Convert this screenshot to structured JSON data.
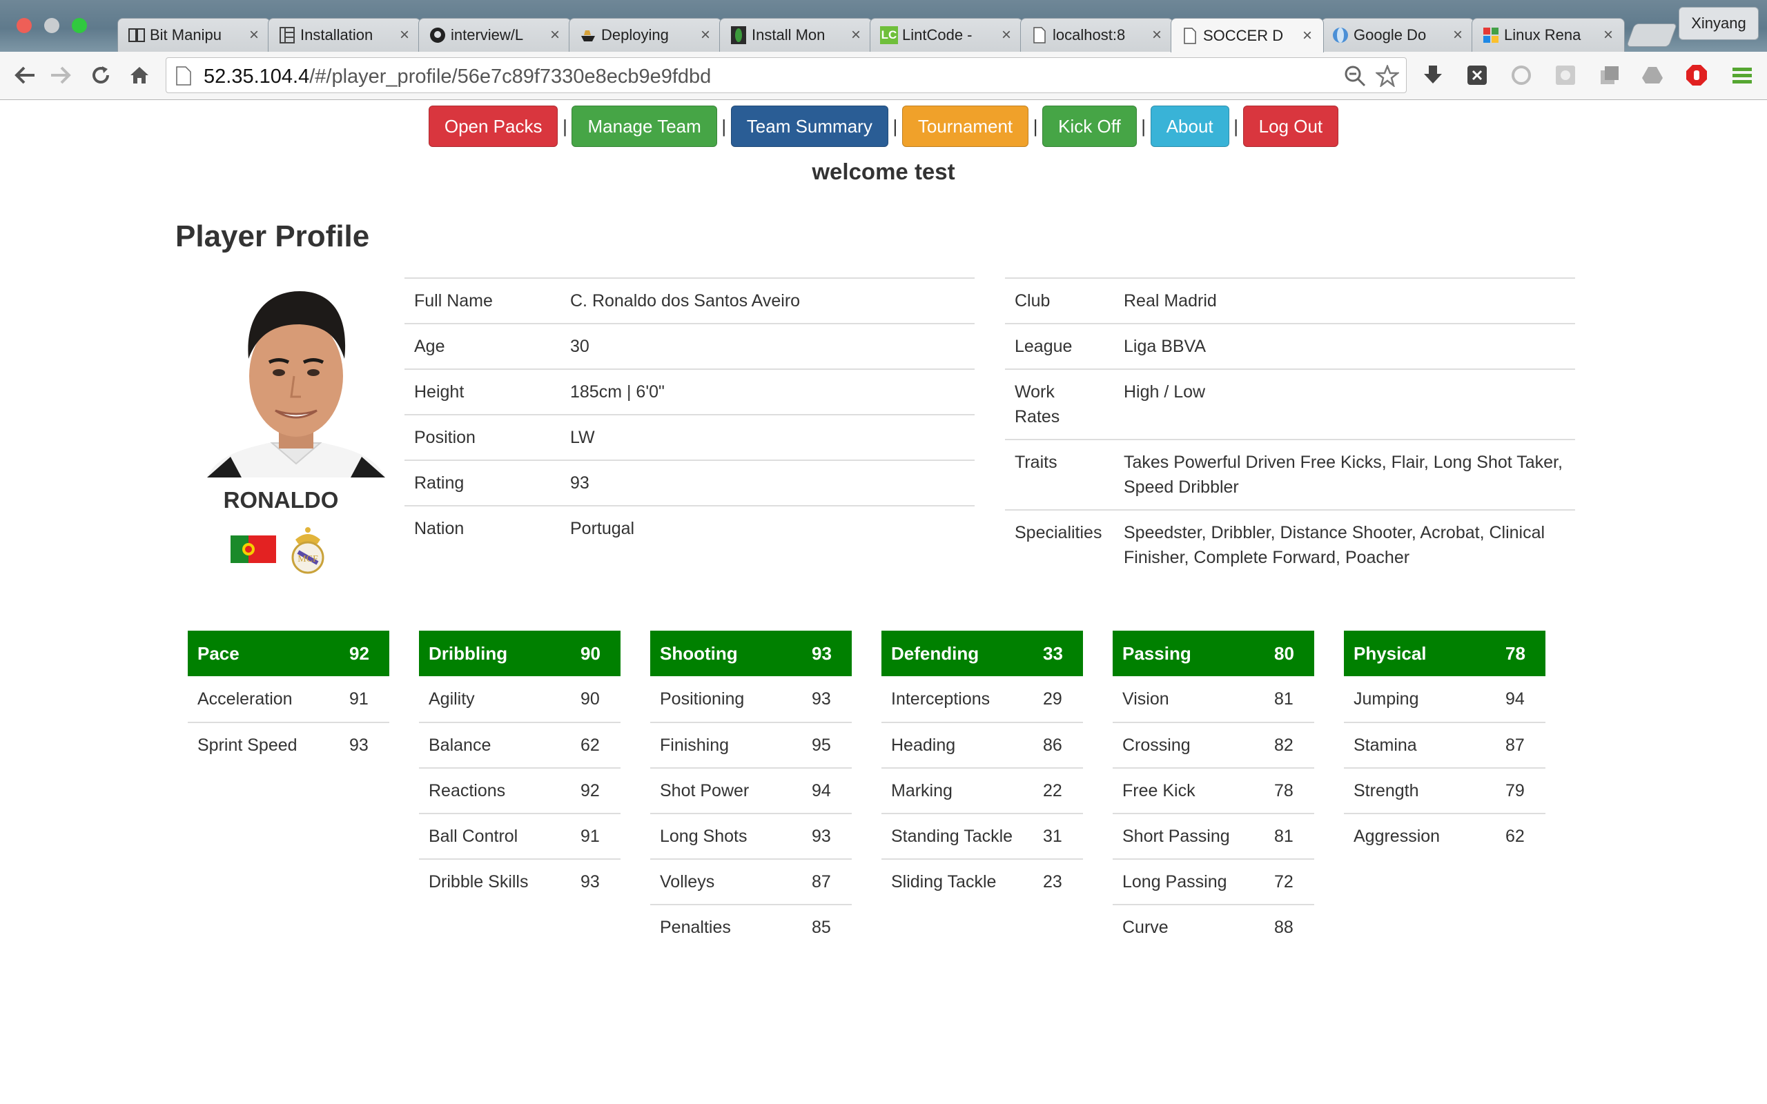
{
  "browser": {
    "tabs": [
      {
        "label": "Bit Manipu",
        "icon": "book-icon",
        "active": false
      },
      {
        "label": "Installation",
        "icon": "grid-icon",
        "active": false
      },
      {
        "label": "interview/L",
        "icon": "github-icon",
        "active": false
      },
      {
        "label": "Deploying",
        "icon": "ship-icon",
        "active": false
      },
      {
        "label": "Install Mon",
        "icon": "leaf-icon",
        "active": false
      },
      {
        "label": "LintCode -",
        "icon": "lc-icon",
        "active": false
      },
      {
        "label": "localhost:8",
        "icon": "page-icon",
        "active": false
      },
      {
        "label": "SOCCER D",
        "icon": "page-icon",
        "active": true
      },
      {
        "label": "Google Do",
        "icon": "globe-icon",
        "active": false
      },
      {
        "label": "Linux Rena",
        "icon": "squares-icon",
        "active": false
      }
    ],
    "profile_name": "Xinyang",
    "url_host": "52.35.104.4",
    "url_path": "/#/player_profile/56e7c89f7330e8ecb9e9fdbd"
  },
  "nav": {
    "open_packs": "Open Packs",
    "manage_team": "Manage Team",
    "team_summary": "Team Summary",
    "tournament": "Tournament",
    "kick_off": "Kick Off",
    "about": "About",
    "log_out": "Log Out",
    "separator": "|"
  },
  "welcome": "welcome test",
  "page_title": "Player Profile",
  "player": {
    "display_name": "RONALDO",
    "left_details": [
      {
        "key": "Full Name",
        "value": "C. Ronaldo dos Santos Aveiro"
      },
      {
        "key": "Age",
        "value": "30"
      },
      {
        "key": "Height",
        "value": "185cm | 6'0\""
      },
      {
        "key": "Position",
        "value": "LW"
      },
      {
        "key": "Rating",
        "value": "93"
      },
      {
        "key": "Nation",
        "value": "Portugal"
      }
    ],
    "right_details": [
      {
        "key": "Club",
        "value": "Real Madrid"
      },
      {
        "key": "League",
        "value": "Liga BBVA"
      },
      {
        "key": "Work Rates",
        "value": "High / Low"
      },
      {
        "key": "Traits",
        "value": "Takes Powerful Driven Free Kicks, Flair, Long Shot Taker, Speed Dribbler"
      },
      {
        "key": "Specialities",
        "value": "Speedster, Dribbler, Distance Shooter, Acrobat, Clinical Finisher, Complete Forward, Poacher"
      }
    ]
  },
  "stats": [
    {
      "name": "Pace",
      "value": "92",
      "attrs": [
        {
          "name": "Acceleration",
          "value": "91"
        },
        {
          "name": "Sprint Speed",
          "value": "93"
        }
      ]
    },
    {
      "name": "Dribbling",
      "value": "90",
      "attrs": [
        {
          "name": "Agility",
          "value": "90"
        },
        {
          "name": "Balance",
          "value": "62"
        },
        {
          "name": "Reactions",
          "value": "92"
        },
        {
          "name": "Ball Control",
          "value": "91"
        },
        {
          "name": "Dribble Skills",
          "value": "93"
        }
      ]
    },
    {
      "name": "Shooting",
      "value": "93",
      "attrs": [
        {
          "name": "Positioning",
          "value": "93"
        },
        {
          "name": "Finishing",
          "value": "95"
        },
        {
          "name": "Shot Power",
          "value": "94"
        },
        {
          "name": "Long Shots",
          "value": "93"
        },
        {
          "name": "Volleys",
          "value": "87"
        },
        {
          "name": "Penalties",
          "value": "85"
        }
      ]
    },
    {
      "name": "Defending",
      "value": "33",
      "attrs": [
        {
          "name": "Interceptions",
          "value": "29"
        },
        {
          "name": "Heading",
          "value": "86"
        },
        {
          "name": "Marking",
          "value": "22"
        },
        {
          "name": "Standing Tackle",
          "value": "31"
        },
        {
          "name": "Sliding Tackle",
          "value": "23"
        }
      ]
    },
    {
      "name": "Passing",
      "value": "80",
      "attrs": [
        {
          "name": "Vision",
          "value": "81"
        },
        {
          "name": "Crossing",
          "value": "82"
        },
        {
          "name": "Free Kick",
          "value": "78"
        },
        {
          "name": "Short Passing",
          "value": "81"
        },
        {
          "name": "Long Passing",
          "value": "72"
        },
        {
          "name": "Curve",
          "value": "88"
        }
      ]
    },
    {
      "name": "Physical",
      "value": "78",
      "attrs": [
        {
          "name": "Jumping",
          "value": "94"
        },
        {
          "name": "Stamina",
          "value": "87"
        },
        {
          "name": "Strength",
          "value": "79"
        },
        {
          "name": "Aggression",
          "value": "62"
        }
      ]
    }
  ],
  "colors": {
    "open_packs": "#d9363e",
    "manage_team": "#46a546",
    "team_summary": "#2a5d95",
    "tournament": "#f0a12a",
    "kick_off": "#46a546",
    "about": "#39b3d7",
    "log_out": "#d9363e",
    "stat_header": "#008000"
  }
}
